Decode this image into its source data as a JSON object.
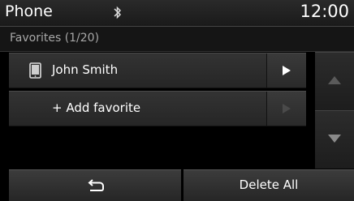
{
  "status_bar": {
    "title": "Phone",
    "bluetooth_icon": "bluetooth-icon",
    "clock": "12:00"
  },
  "subheader": {
    "text": "Favorites (1/20)"
  },
  "favorites": [
    {
      "label": "John Smith",
      "icon": "phone-device-icon",
      "arrow_enabled": true
    },
    {
      "label": "+ Add favorite",
      "icon": null,
      "arrow_enabled": false
    }
  ],
  "scroll": {
    "up_icon": "triangle-up-icon",
    "down_icon": "triangle-down-icon"
  },
  "bottom_bar": {
    "back_icon": "back-arrow-icon",
    "delete_all_label": "Delete All"
  },
  "colors": {
    "background": "#000000",
    "panel": "#2a2a2a",
    "text": "#ffffff",
    "muted_text": "#a7a7a7",
    "disabled": "#4a4a4a"
  }
}
